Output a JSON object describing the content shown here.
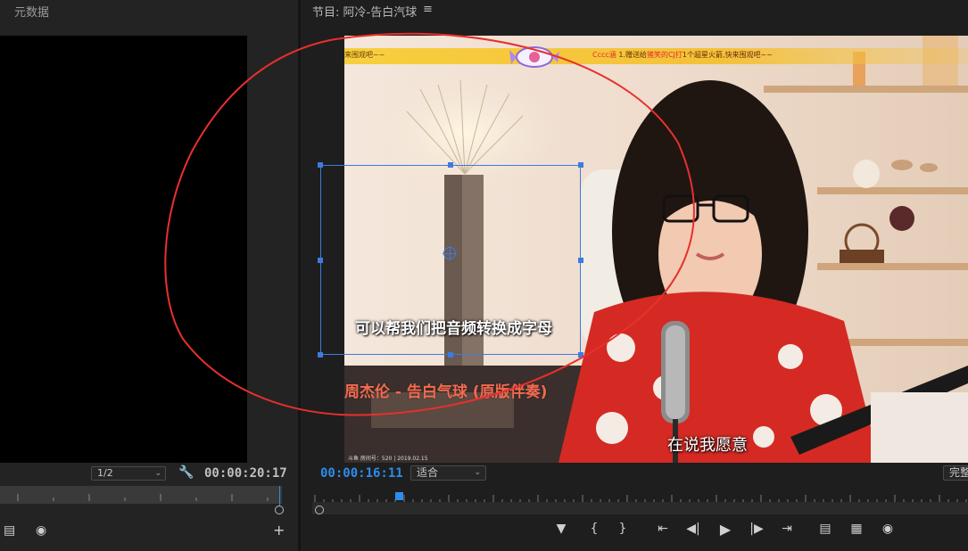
{
  "source_panel": {
    "title": "元数据",
    "zoom": "1/2",
    "timecode": "00:00:20:17",
    "icons": [
      "export-frame-icon",
      "camera-icon",
      "add-icon",
      "wrench-icon"
    ]
  },
  "program_panel": {
    "title": "节目: 阿冷-告白汽球",
    "menu_icon": "hamburger-menu-icon",
    "timecode": "00:00:16:11",
    "fit": "适合",
    "quality": "完整",
    "transport": [
      "marker-icon",
      "mark-in-icon",
      "mark-out-icon",
      "go-to-in-icon",
      "step-back-icon",
      "play-icon",
      "step-forward-icon",
      "go-to-out-icon",
      "lift-icon",
      "extract-icon",
      "camera-icon"
    ]
  },
  "video": {
    "danmaku_left": "来围观吧~~",
    "danmaku_user": "Cccc涵",
    "danmaku_text1": " 1.赠送给",
    "danmaku_highlight": "猪笑的CJ打",
    "danmaku_text2": "1个超星火箭,快来围观吧~~",
    "subtitle": "可以帮我们把音频转换成字母",
    "song_title": "周杰伦 - 告白气球 (原版伴奏)",
    "lyric": "在说我愿意",
    "stream_info": "斗鱼 房间号：520 | 2019.02.15"
  },
  "colors": {
    "accent_blue": "#2d8ceb",
    "annotation_red": "#e8302c",
    "panel_bg": "#232323"
  }
}
